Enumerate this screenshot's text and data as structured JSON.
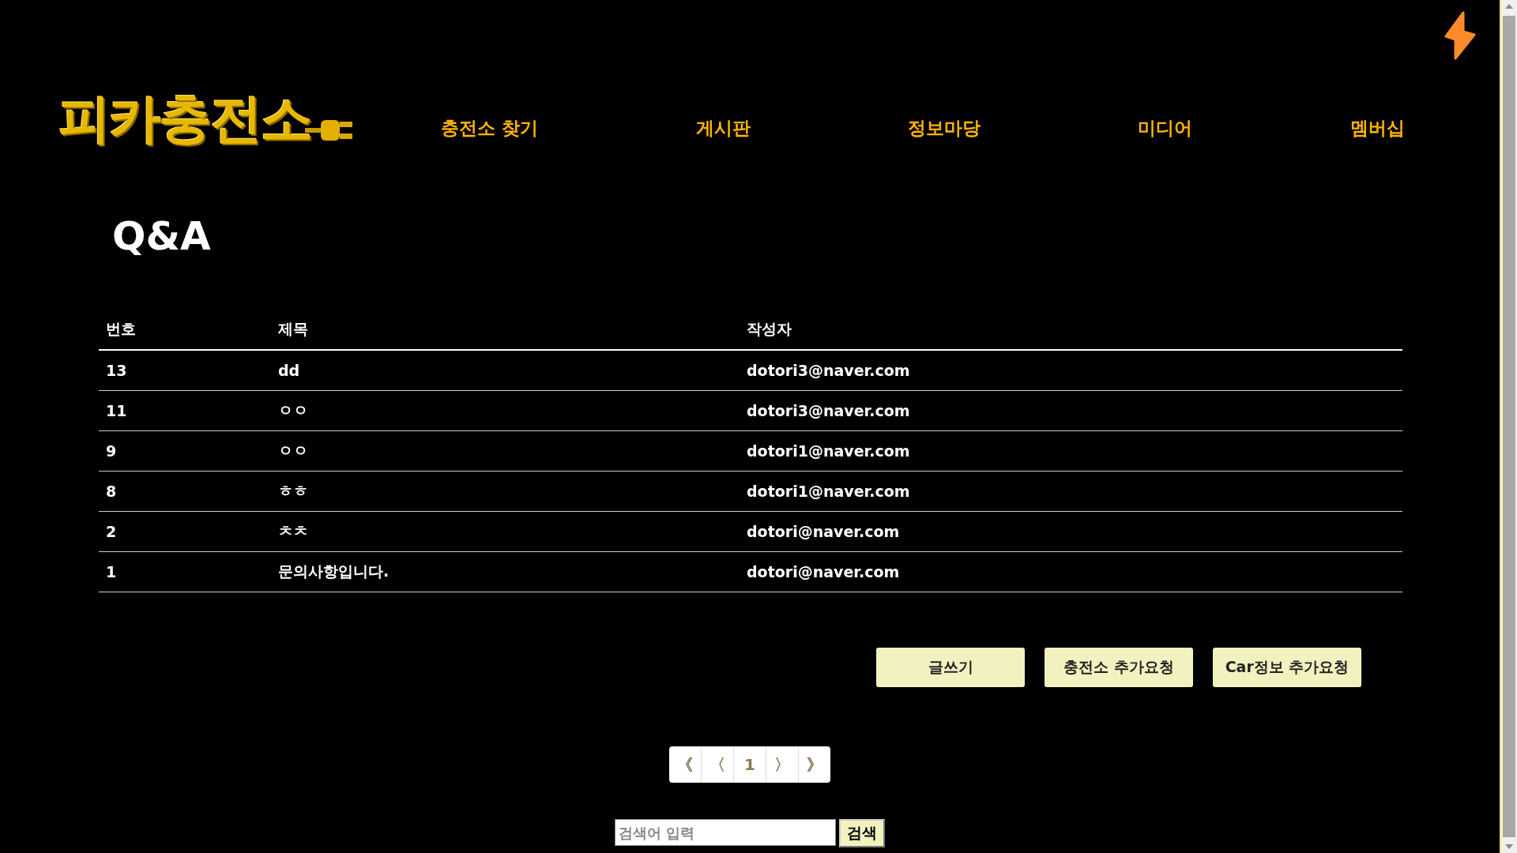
{
  "header": {
    "logo": "피카충전소",
    "nav": [
      "충전소 찾기",
      "게시판",
      "정보마당",
      "미디어",
      "멤버십"
    ]
  },
  "page_title": "Q&A",
  "table": {
    "columns": [
      "번호",
      "제목",
      "작성자"
    ],
    "rows": [
      {
        "number": "13",
        "title": "dd",
        "author": "dotori3@naver.com"
      },
      {
        "number": "11",
        "title": "ㅇㅇ",
        "author": "dotori3@naver.com"
      },
      {
        "number": "9",
        "title": "ㅇㅇ",
        "author": "dotori1@naver.com"
      },
      {
        "number": "8",
        "title": "ㅎㅎ",
        "author": "dotori1@naver.com"
      },
      {
        "number": "2",
        "title": "ㅊㅊ",
        "author": "dotori@naver.com"
      },
      {
        "number": "1",
        "title": "문의사항입니다.",
        "author": "dotori@naver.com"
      }
    ]
  },
  "actions": [
    "글쓰기",
    "충전소 추가요청",
    "Car정보 추가요청"
  ],
  "pagination": [
    "《",
    "〈",
    "1",
    "〉",
    "》"
  ],
  "search": {
    "placeholder": "검색어 입력",
    "button": "검색"
  }
}
